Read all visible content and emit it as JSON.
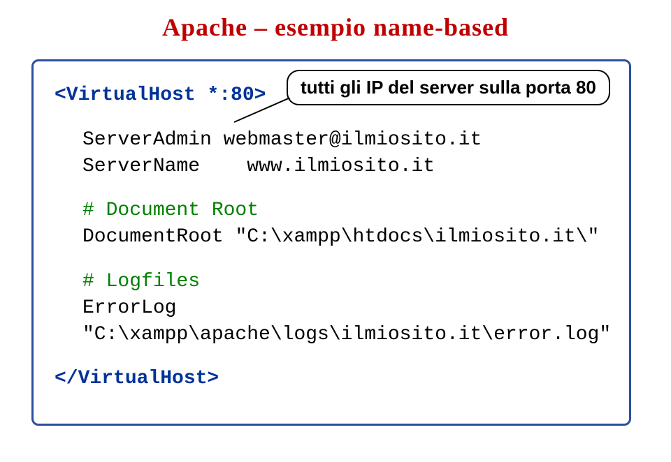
{
  "title": "Apache – esempio name-based",
  "callout": "tutti gli IP del server sulla porta 80",
  "code": {
    "vhost_open": "<VirtualHost *:80>",
    "serveradmin_key": "ServerAdmin",
    "serveradmin_val": "webmaster@ilmiosito.it",
    "servername_key": "ServerName",
    "servername_val": "www.ilmiosito.it",
    "comment_docroot": "# Document Root",
    "docroot_key": "DocumentRoot",
    "docroot_val": "\"C:\\xampp\\htdocs\\ilmiosito.it\\\"",
    "comment_logfiles": "# Logfiles",
    "errorlog_key": "ErrorLog",
    "errorlog_val": "\"C:\\xampp\\apache\\logs\\ilmiosito.it\\error.log\"",
    "vhost_close": "</VirtualHost>"
  }
}
